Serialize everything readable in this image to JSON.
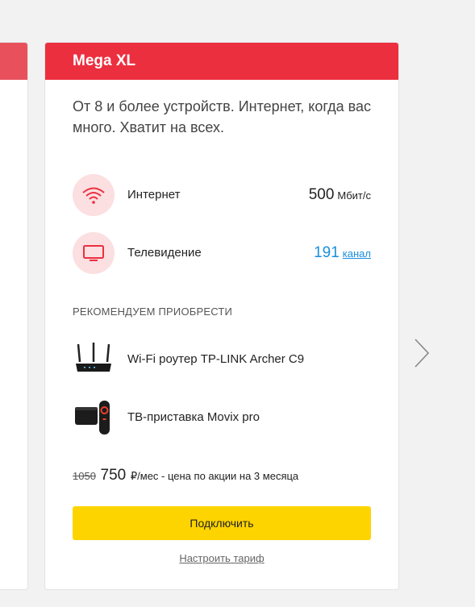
{
  "card": {
    "title": "Mega XL",
    "description": "От 8 и более устройств. Интернет, когда вас много. Хватит на всех.",
    "features": [
      {
        "label": "Интернет",
        "value": "500",
        "unit": "Мбит/с",
        "icon": "wifi-icon"
      },
      {
        "label": "Телевидение",
        "value": "191",
        "unit": "канал",
        "icon": "tv-icon"
      }
    ],
    "recommend_title": "РЕКОМЕНДУЕМ ПРИОБРЕСТИ",
    "devices": [
      {
        "name": "Wi-Fi роутер TP-LINK Archer C9",
        "icon": "router-image"
      },
      {
        "name": "ТВ-приставка Movix pro",
        "icon": "tv-box-image"
      }
    ],
    "price": {
      "old": "1050",
      "new": "750",
      "suffix": "₽/мес - цена по акции на 3 месяца"
    },
    "connect_label": "Подключить",
    "configure_label": "Настроить тариф"
  },
  "colors": {
    "header_red": "#ec2f3f",
    "accent_blue": "#1a8fdc",
    "button_yellow": "#fed400",
    "icon_bg": "#fbdfe1"
  }
}
